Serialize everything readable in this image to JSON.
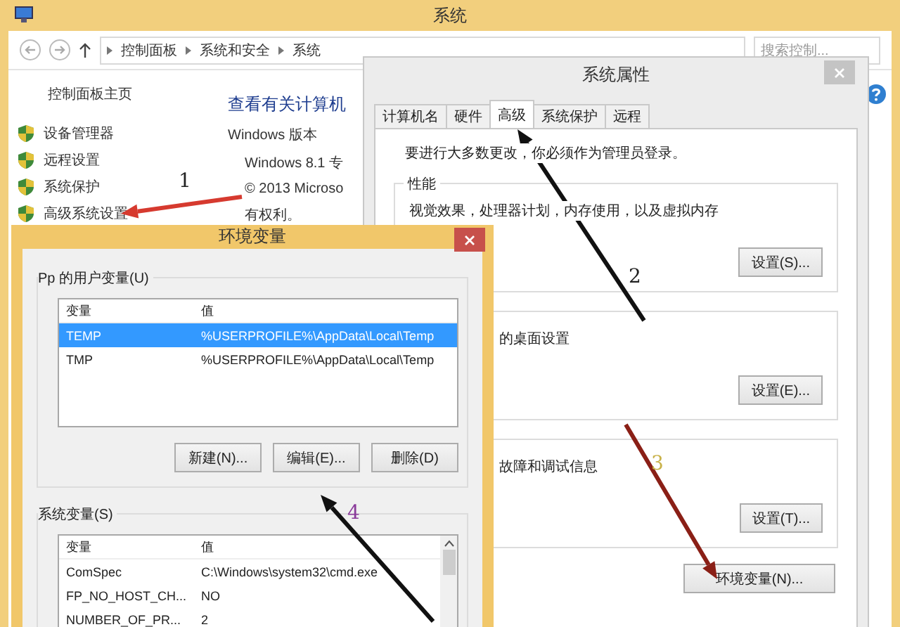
{
  "main_window": {
    "title": "系统",
    "breadcrumb": [
      "控制面板",
      "系统和安全",
      "系统"
    ],
    "search": {
      "placeholder": "搜索控制..."
    },
    "sidebar": {
      "home": "控制面板主页",
      "items": [
        "设备管理器",
        "远程设置",
        "系统保护",
        "高级系统设置"
      ]
    },
    "content": {
      "heading": "查看有关计算机",
      "section": "Windows 版本",
      "lines": [
        "Windows 8.1 专",
        "© 2013 Microso",
        "有权利。"
      ]
    }
  },
  "system_properties": {
    "title": "系统属性",
    "tabs": [
      {
        "label": "计算机名",
        "selected": false
      },
      {
        "label": "硬件",
        "selected": false
      },
      {
        "label": "高级",
        "selected": true
      },
      {
        "label": "系统保护",
        "selected": false
      },
      {
        "label": "远程",
        "selected": false
      }
    ],
    "notice": "要进行大多数更改，你必须作为管理员登录。",
    "groups": [
      {
        "label": "性能",
        "text": "视觉效果，处理器计划，内存使用，以及虚拟内存",
        "button": "设置(S)..."
      },
      {
        "text": "的桌面设置",
        "button": "设置(E)..."
      },
      {
        "text": "故障和调试信息",
        "button": "设置(T)..."
      }
    ],
    "env_button": "环境变量(N)..."
  },
  "environment_variables": {
    "title": "环境变量",
    "user_group": {
      "label": "Pp 的用户变量(U)",
      "columns": [
        "变量",
        "值"
      ],
      "rows": [
        {
          "name": "TEMP",
          "value": "%USERPROFILE%\\AppData\\Local\\Temp",
          "selected": true
        },
        {
          "name": "TMP",
          "value": "%USERPROFILE%\\AppData\\Local\\Temp",
          "selected": false
        }
      ],
      "buttons": [
        "新建(N)...",
        "编辑(E)...",
        "删除(D)"
      ]
    },
    "system_group": {
      "label": "系统变量(S)",
      "columns": [
        "变量",
        "值"
      ],
      "rows": [
        {
          "name": "ComSpec",
          "value": "C:\\Windows\\system32\\cmd.exe",
          "selected": false
        },
        {
          "name": "FP_NO_HOST_CH...",
          "value": "NO",
          "selected": false
        },
        {
          "name": "NUMBER_OF_PR...",
          "value": "2",
          "selected": false
        }
      ]
    }
  },
  "annotations": [
    {
      "arrow": {
        "color": "#d63a2f"
      },
      "number": {
        "label": "1",
        "color": "#222222"
      }
    },
    {
      "arrow": {
        "color": "#111111"
      },
      "number": {
        "label": "2",
        "color": "#222222"
      }
    },
    {
      "arrow": {
        "color": "#8a1f16"
      },
      "number": {
        "label": "3",
        "color": "#c9b24a"
      }
    },
    {
      "arrow": {
        "color": "#111111"
      },
      "number": {
        "label": "4",
        "color": "#8a3a9a"
      }
    }
  ]
}
